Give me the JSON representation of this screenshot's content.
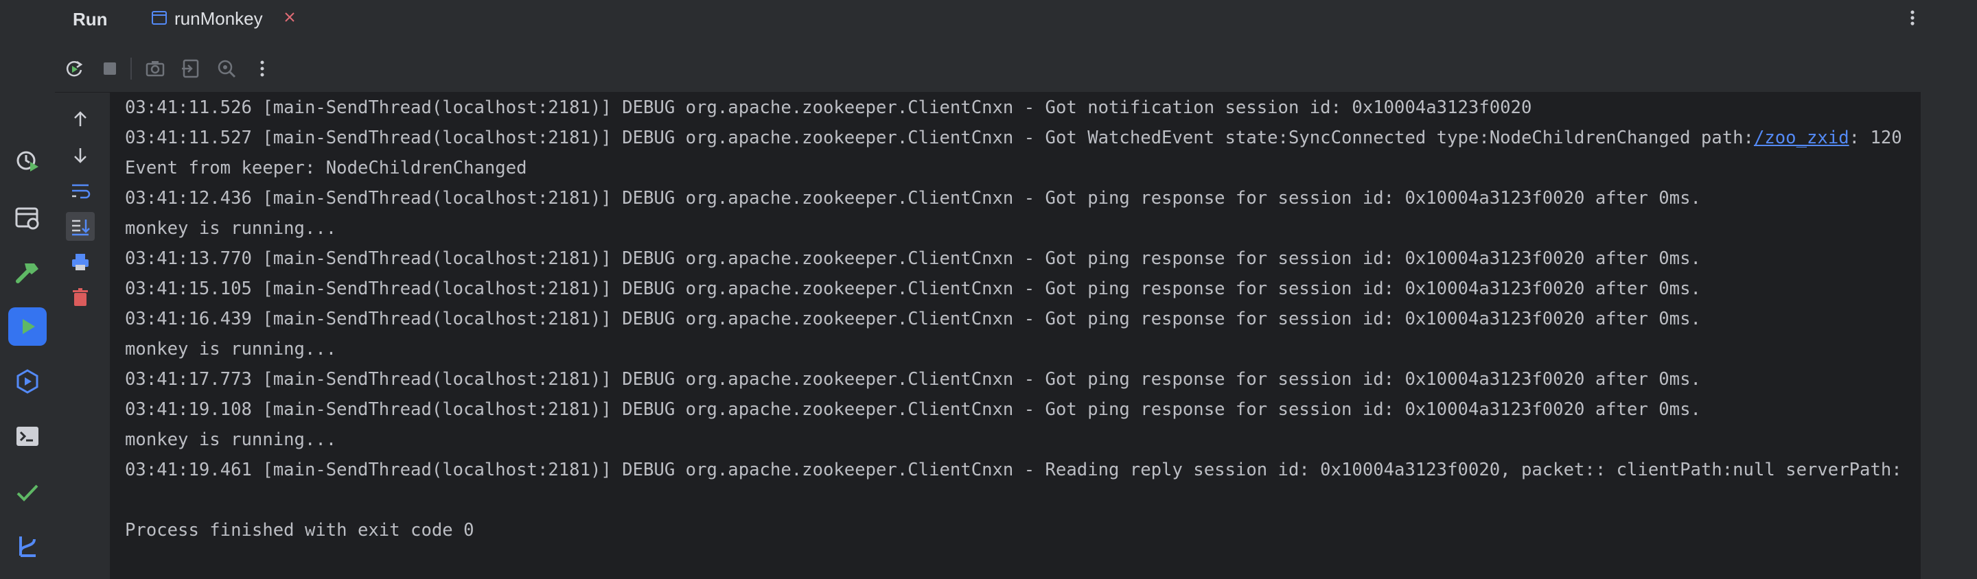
{
  "header": {
    "title": "Run",
    "tab": {
      "label": "runMonkey"
    }
  },
  "left_stripe": {
    "items": [
      "history-icon",
      "services-icon",
      "build-icon",
      "run-icon",
      "endpoints-icon",
      "terminal-icon",
      "problems-icon",
      "git-icon"
    ]
  },
  "toolbar": {
    "items": [
      "rerun-icon",
      "stop-icon",
      "screenshot-icon",
      "export-icon",
      "settings-icon",
      "more-icon"
    ]
  },
  "gutter": {
    "items": [
      "up-arrow-icon",
      "down-arrow-icon",
      "soft-wrap-icon",
      "scroll-to-end-icon",
      "print-icon",
      "clear-all-icon"
    ]
  },
  "console": {
    "lines": [
      {
        "text": "03:41:11.526 [main-SendThread(localhost:2181)] DEBUG org.apache.zookeeper.ClientCnxn - Got notification session id: 0x10004a3123f0020"
      },
      {
        "text": "03:41:11.527 [main-SendThread(localhost:2181)] DEBUG org.apache.zookeeper.ClientCnxn - Got WatchedEvent state:SyncConnected type:NodeChildrenChanged path:",
        "link": "/zoo_zxid",
        "suffix": ": 120"
      },
      {
        "text": "Event from keeper: NodeChildrenChanged"
      },
      {
        "text": "03:41:12.436 [main-SendThread(localhost:2181)] DEBUG org.apache.zookeeper.ClientCnxn - Got ping response for session id: 0x10004a3123f0020 after 0ms."
      },
      {
        "text": "monkey is running..."
      },
      {
        "text": "03:41:13.770 [main-SendThread(localhost:2181)] DEBUG org.apache.zookeeper.ClientCnxn - Got ping response for session id: 0x10004a3123f0020 after 0ms."
      },
      {
        "text": "03:41:15.105 [main-SendThread(localhost:2181)] DEBUG org.apache.zookeeper.ClientCnxn - Got ping response for session id: 0x10004a3123f0020 after 0ms."
      },
      {
        "text": "03:41:16.439 [main-SendThread(localhost:2181)] DEBUG org.apache.zookeeper.ClientCnxn - Got ping response for session id: 0x10004a3123f0020 after 0ms."
      },
      {
        "text": "monkey is running..."
      },
      {
        "text": "03:41:17.773 [main-SendThread(localhost:2181)] DEBUG org.apache.zookeeper.ClientCnxn - Got ping response for session id: 0x10004a3123f0020 after 0ms."
      },
      {
        "text": "03:41:19.108 [main-SendThread(localhost:2181)] DEBUG org.apache.zookeeper.ClientCnxn - Got ping response for session id: 0x10004a3123f0020 after 0ms."
      },
      {
        "text": "monkey is running..."
      },
      {
        "text": "03:41:19.461 [main-SendThread(localhost:2181)] DEBUG org.apache.zookeeper.ClientCnxn - Reading reply session id: 0x10004a3123f0020, packet:: clientPath:null serverPath:"
      },
      {
        "text": ""
      },
      {
        "text": "Process finished with exit code 0"
      }
    ]
  },
  "colors": {
    "accent": "#3574f0",
    "link": "#548af7",
    "close": "#e06c75",
    "success": "#5fb865",
    "danger": "#db5c5c"
  }
}
